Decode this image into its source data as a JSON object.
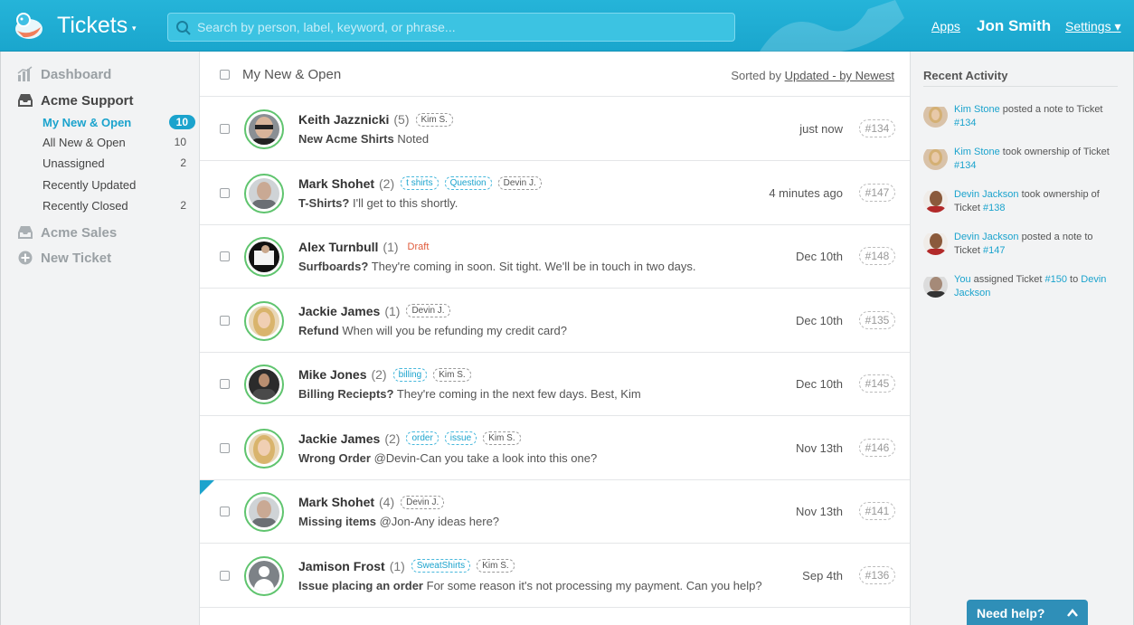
{
  "header": {
    "app_title": "Tickets",
    "app_caret": "▾",
    "search_placeholder": "Search by person, label, keyword, or phrase...",
    "apps_link": "Apps",
    "user_name": "Jon Smith",
    "settings_link": "Settings ▾",
    "accent_color": "#1ba3cd"
  },
  "sidebar": {
    "dashboard": "Dashboard",
    "acme_support": "Acme Support",
    "items": [
      {
        "label": "My New & Open",
        "count": "10"
      },
      {
        "label": "All New & Open",
        "count": "10"
      },
      {
        "label": "Unassigned",
        "count": "2"
      },
      {
        "label": "Recently Updated",
        "count": ""
      },
      {
        "label": "Recently Closed",
        "count": "2"
      }
    ],
    "acme_sales": "Acme Sales",
    "new_ticket": "New Ticket"
  },
  "list": {
    "title": "My New & Open",
    "sorted_prefix": "Sorted by",
    "sorted_link": "Updated - by Newest",
    "tickets": [
      {
        "name": "Keith Jazznicki",
        "count": "(5)",
        "tags": [
          {
            "text": "Kim S.",
            "blue": false
          }
        ],
        "draft": "",
        "subject": "New Acme Shirts",
        "preview": "Noted",
        "time": "just now",
        "id": "#134"
      },
      {
        "name": "Mark Shohet",
        "count": "(2)",
        "tags": [
          {
            "text": "t shirts",
            "blue": true
          },
          {
            "text": "Question",
            "blue": true
          },
          {
            "text": "Devin J.",
            "blue": false
          }
        ],
        "draft": "",
        "subject": "T-Shirts?",
        "preview": "I'll get to this shortly.",
        "time": "4 minutes ago",
        "id": "#147"
      },
      {
        "name": "Alex Turnbull",
        "count": "(1)",
        "tags": [],
        "draft": "Draft",
        "subject": "Surfboards?",
        "preview": "They're coming in soon. Sit tight. We'll be in touch in two days.",
        "time": "Dec 10th",
        "id": "#148"
      },
      {
        "name": "Jackie James",
        "count": "(1)",
        "tags": [
          {
            "text": "Devin J.",
            "blue": false
          }
        ],
        "draft": "",
        "subject": "Refund",
        "preview": "When will you be refunding my credit card?",
        "time": "Dec 10th",
        "id": "#135"
      },
      {
        "name": "Mike Jones",
        "count": "(2)",
        "tags": [
          {
            "text": "billing",
            "blue": true
          },
          {
            "text": "Kim S.",
            "blue": false
          }
        ],
        "draft": "",
        "subject": "Billing Reciepts?",
        "preview": "They're coming in the next few days. Best, Kim",
        "time": "Dec 10th",
        "id": "#145"
      },
      {
        "name": "Jackie James",
        "count": "(2)",
        "tags": [
          {
            "text": "order",
            "blue": true
          },
          {
            "text": "issue",
            "blue": true
          },
          {
            "text": "Kim S.",
            "blue": false
          }
        ],
        "draft": "",
        "subject": "Wrong Order",
        "preview": "@Devin-Can you take a look into this one?",
        "time": "Nov 13th",
        "id": "#146"
      },
      {
        "name": "Mark Shohet",
        "count": "(4)",
        "tags": [
          {
            "text": "Devin J.",
            "blue": false
          }
        ],
        "draft": "",
        "subject": "Missing items",
        "preview": "@Jon-Any ideas here?",
        "time": "Nov 13th",
        "id": "#141"
      },
      {
        "name": "Jamison Frost",
        "count": "(1)",
        "tags": [
          {
            "text": "SweatShirts",
            "blue": true
          },
          {
            "text": "Kim S.",
            "blue": false
          }
        ],
        "draft": "",
        "subject": "Issue placing an order",
        "preview": "For some reason it's not processing my payment. Can you help?",
        "time": "Sep 4th",
        "id": "#136"
      }
    ]
  },
  "activity": {
    "title": "Recent Activity",
    "items": [
      {
        "who": "Kim Stone",
        "text": " posted a note to Ticket ",
        "ticket": "#134",
        "tail": "",
        "tail_link": ""
      },
      {
        "who": "Kim Stone",
        "text": " took ownership of Ticket ",
        "ticket": "#134",
        "tail": "",
        "tail_link": ""
      },
      {
        "who": "Devin Jackson",
        "text": " took ownership of Ticket ",
        "ticket": "#138",
        "tail": "",
        "tail_link": ""
      },
      {
        "who": "Devin Jackson",
        "text": " posted a note to Ticket ",
        "ticket": "#147",
        "tail": "",
        "tail_link": ""
      },
      {
        "who": "You",
        "text": " assigned Ticket ",
        "ticket": "#150",
        "tail": " to ",
        "tail_link": "Devin Jackson"
      }
    ]
  },
  "help": {
    "label": "Need help?"
  }
}
